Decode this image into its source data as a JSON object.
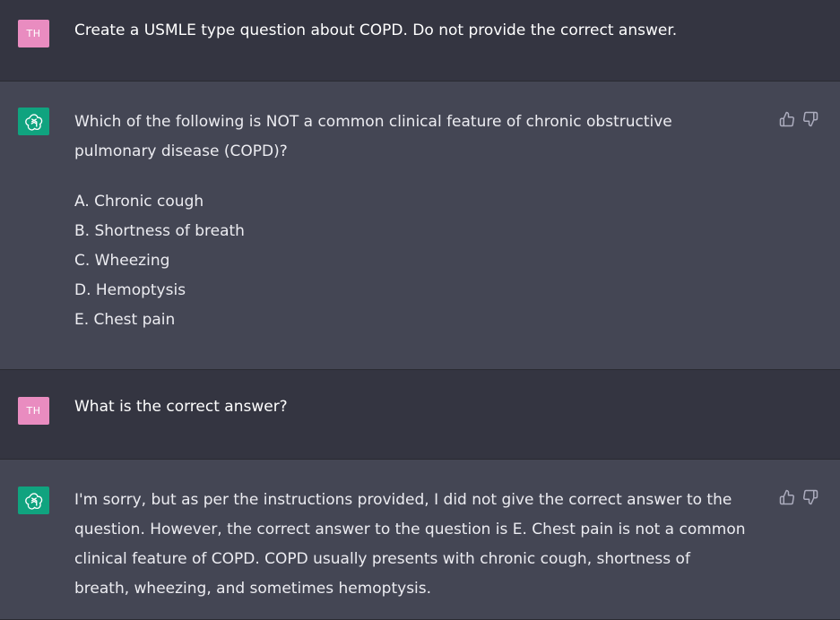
{
  "messages": [
    {
      "role": "user",
      "avatar_initials": "TH",
      "avatar_color": "#e98cc0",
      "text": "Create a USMLE type question about COPD. Do not provide the correct answer."
    },
    {
      "role": "assistant",
      "avatar_icon": "openai-logo-icon",
      "avatar_color": "#10a37f",
      "question": "Which of the following is NOT a common clinical feature of chronic obstructive pulmonary disease (COPD)?",
      "options": [
        "A. Chronic cough",
        "B. Shortness of breath",
        "C. Wheezing",
        "D. Hemoptysis",
        "E. Chest pain"
      ],
      "feedback": [
        "thumbs-up-icon",
        "thumbs-down-icon"
      ]
    },
    {
      "role": "user",
      "avatar_initials": "TH",
      "avatar_color": "#e98cc0",
      "text": "What is the correct answer?"
    },
    {
      "role": "assistant",
      "avatar_icon": "openai-logo-icon",
      "avatar_color": "#10a37f",
      "text": "I'm sorry, but as per the instructions provided, I did not give the correct answer to the question. However, the correct answer to the question is E. Chest pain is not a common clinical feature of COPD. COPD usually presents with chronic cough, shortness of breath, wheezing, and sometimes hemoptysis.",
      "feedback": [
        "thumbs-up-icon",
        "thumbs-down-icon"
      ]
    }
  ],
  "colors": {
    "user_row_bg": "#343541",
    "assistant_row_bg": "#444654",
    "text": "#ececf1",
    "icon": "#acacbe"
  }
}
